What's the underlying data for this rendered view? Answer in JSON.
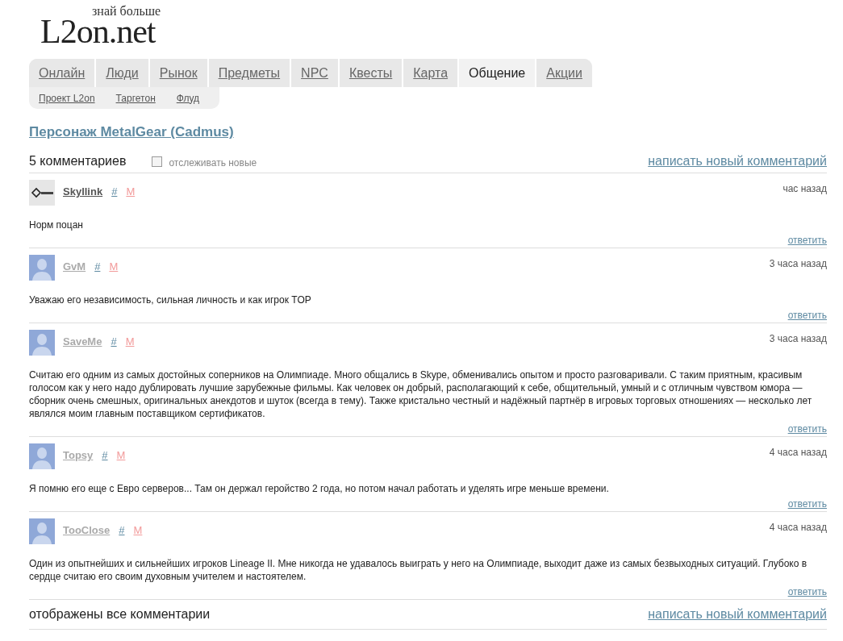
{
  "logo": {
    "main": "L2on.net",
    "tagline": "знай больше"
  },
  "tabs": [
    {
      "label": "Онлайн",
      "selected": false
    },
    {
      "label": "Люди",
      "selected": false
    },
    {
      "label": "Рынок",
      "selected": false
    },
    {
      "label": "Предметы",
      "selected": false
    },
    {
      "label": "NPC",
      "selected": false
    },
    {
      "label": "Квесты",
      "selected": false
    },
    {
      "label": "Карта",
      "selected": false
    },
    {
      "label": "Общение",
      "selected": true
    },
    {
      "label": "Акции",
      "selected": false
    }
  ],
  "subtabs": [
    {
      "label": "Проект L2on"
    },
    {
      "label": "Таргетон"
    },
    {
      "label": "Флуд"
    }
  ],
  "title": "Персонаж MetalGear (Cadmus)",
  "comments_header": {
    "count": "5 комментариев",
    "follow": {
      "label": "отслеживать новые",
      "checked": false
    },
    "write_link": "написать новый комментарий"
  },
  "comments": [
    {
      "author": "Skyllink",
      "kind": "logo",
      "highlighted": true,
      "anchor": "#",
      "mark": "M",
      "time": "час назад",
      "text": "Норм поцан",
      "reply": "ответить"
    },
    {
      "author": "GvM",
      "kind": "silhouette",
      "highlighted": false,
      "anchor": "#",
      "mark": "M",
      "time": "3 часа назад",
      "text": "Уважаю его независимость, сильная личность и как игрок TOP",
      "reply": "ответить"
    },
    {
      "author": "SaveMe",
      "kind": "silhouette",
      "highlighted": false,
      "anchor": "#",
      "mark": "M",
      "time": "3 часа назад",
      "text": "Считаю его одним из самых достойных соперников на Олимпиаде. Много общались в Skype, обменивались опытом и просто разговаривали. С таким приятным, красивым голосом как у него надо дублировать лучшие зарубежные фильмы. Как человек он добрый, располагающий к себе, общительный, умный и с отличным чувством юмора — сборник очень смешных, оригинальных анекдотов и шуток (всегда в тему). Также кристально честный и надёжный партнёр в игровых торговых отношениях — несколько лет являлся моим главным поставщиком сертификатов.",
      "reply": "ответить"
    },
    {
      "author": "Topsy",
      "kind": "silhouette",
      "highlighted": false,
      "anchor": "#",
      "mark": "M",
      "time": "4 часа назад",
      "text": "Я помню его еще с Евро серверов... Там он держал геройство 2 года, но потом начал работать и уделять игре меньше времени.",
      "reply": "ответить"
    },
    {
      "author": "TooClose",
      "kind": "silhouette",
      "highlighted": false,
      "anchor": "#",
      "mark": "M",
      "time": "4 часа назад",
      "text": "Один из опытнейших и сильнейших игроков Lineage II. Мне никогда не удавалось выиграть у него на Олимпиаде, выходит даже из самых безвыходных ситуаций. Глубоко в сердце считаю его своим духовным учителем и настоятелем.",
      "reply": "ответить"
    }
  ],
  "footer": {
    "status": "отображены все комментарии",
    "write_link": "написать новый комментарий"
  }
}
